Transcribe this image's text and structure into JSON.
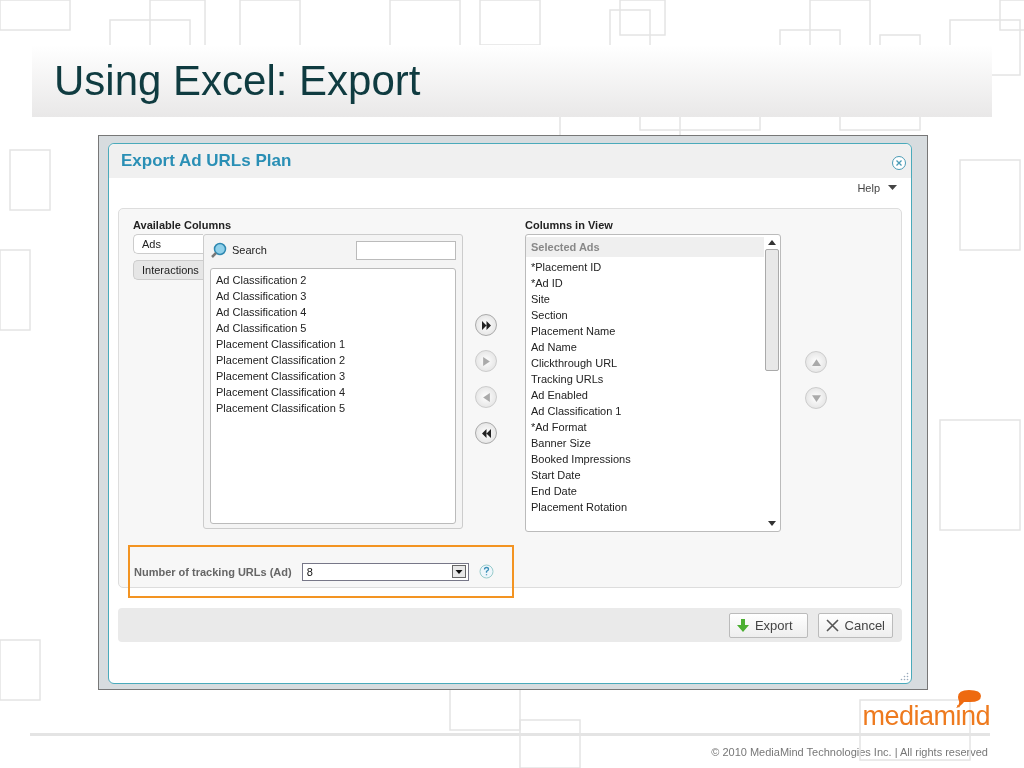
{
  "slide": {
    "title": "Using Excel: Export",
    "logo": "mediamind",
    "footer": "© 2010 MediaMind Technologies Inc. | All rights reserved"
  },
  "dialog": {
    "title": "Export Ad URLs Plan",
    "help": "Help",
    "available": {
      "label": "Available Columns",
      "tabs": [
        {
          "label": "Ads",
          "selected": true
        },
        {
          "label": "Interactions",
          "selected": false
        }
      ],
      "search": {
        "label": "Search"
      },
      "items": [
        "Ad Classification 2",
        "Ad Classification 3",
        "Ad Classification 4",
        "Ad Classification 5",
        "Placement Classification 1",
        "Placement Classification 2",
        "Placement Classification 3",
        "Placement Classification 4",
        "Placement Classification 5"
      ]
    },
    "move_buttons": [
      {
        "kind": "add-all",
        "disabled": false
      },
      {
        "kind": "add",
        "disabled": true
      },
      {
        "kind": "remove",
        "disabled": true
      },
      {
        "kind": "remove-all",
        "disabled": false
      }
    ],
    "in_view": {
      "label": "Columns in View",
      "header": "Selected Ads",
      "items": [
        "*Placement ID",
        "*Ad ID",
        "Site",
        "Section",
        "Placement Name",
        "Ad Name",
        "Clickthrough URL",
        "Tracking URLs",
        "Ad Enabled",
        "Ad Classification 1",
        "*Ad Format",
        "Banner Size",
        "Booked Impressions",
        "Start Date",
        "End Date",
        "Placement Rotation"
      ]
    },
    "order_buttons": [
      {
        "kind": "up",
        "disabled": true
      },
      {
        "kind": "down",
        "disabled": true
      }
    ],
    "tracking": {
      "label": "Number of tracking URLs (Ad)",
      "value": "8"
    },
    "buttons": [
      {
        "kind": "export",
        "label": "Export"
      },
      {
        "kind": "cancel",
        "label": "Cancel"
      }
    ]
  }
}
